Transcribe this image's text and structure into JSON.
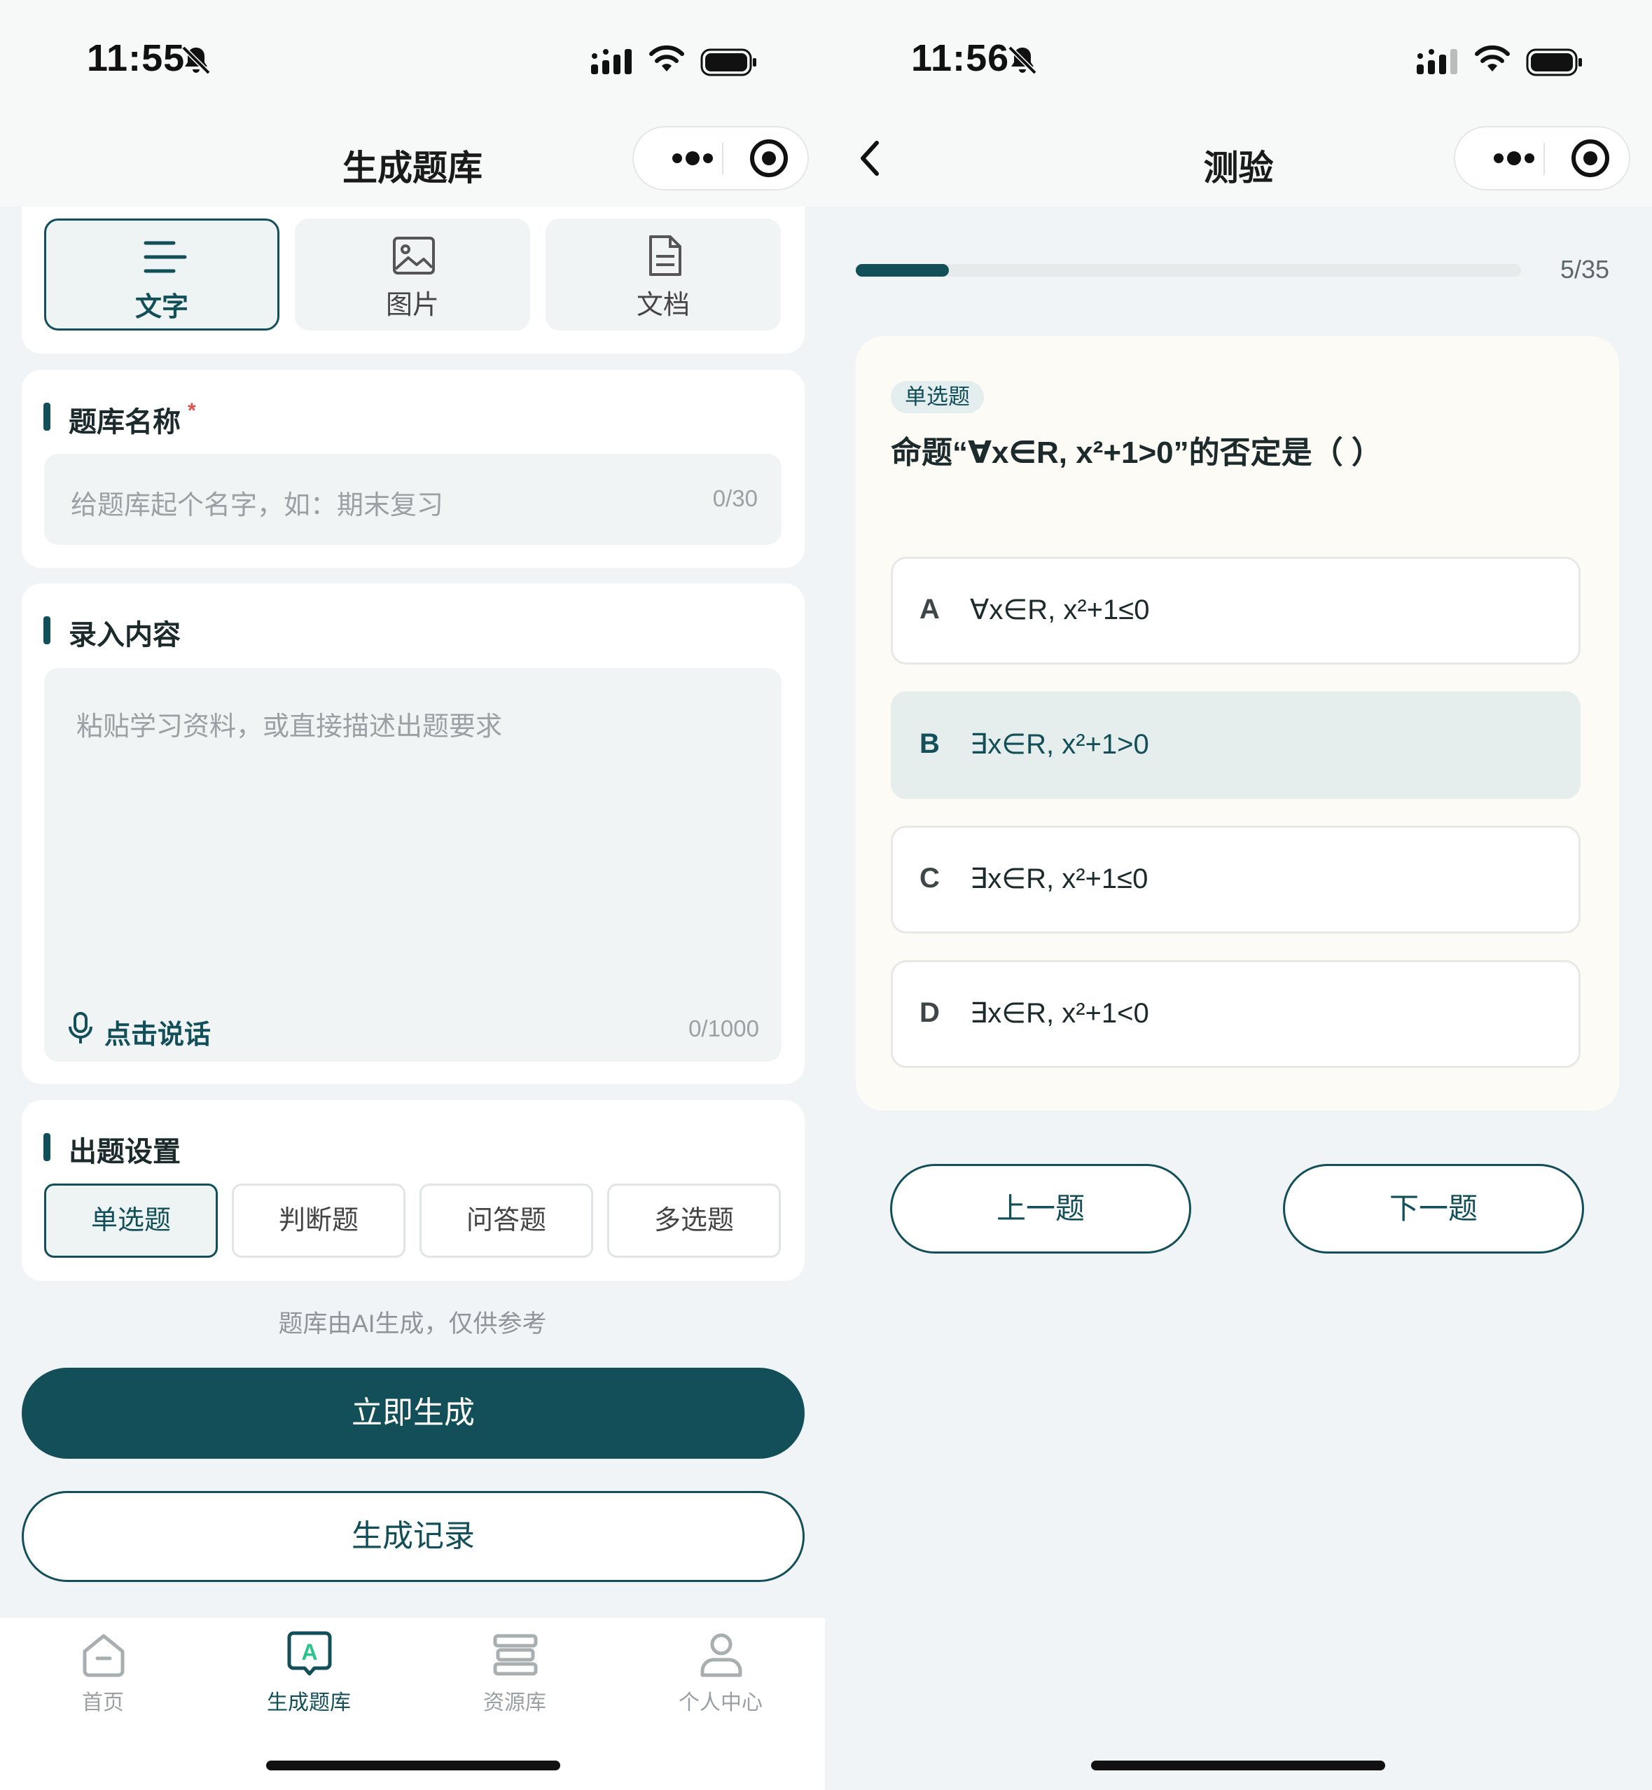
{
  "left": {
    "status": {
      "time": "11:55"
    },
    "nav": {
      "title": "生成题库"
    },
    "input_modes": [
      {
        "label": "文字",
        "icon": "text-lines-icon",
        "active": true
      },
      {
        "label": "图片",
        "icon": "image-icon",
        "active": false
      },
      {
        "label": "文档",
        "icon": "document-icon",
        "active": false
      }
    ],
    "bank_name": {
      "title": "题库名称",
      "required_mark": "*",
      "placeholder": "给题库起个名字，如：期末复习",
      "counter": "0/30"
    },
    "content": {
      "title": "录入内容",
      "placeholder": "粘贴学习资料，或直接描述出题要求",
      "voice_label": "点击说话",
      "counter": "0/1000"
    },
    "settings": {
      "title": "出题设置",
      "types": [
        {
          "label": "单选题",
          "active": true
        },
        {
          "label": "判断题",
          "active": false
        },
        {
          "label": "问答题",
          "active": false
        },
        {
          "label": "多选题",
          "active": false
        }
      ]
    },
    "disclaimer": "题库由AI生成，仅供参考",
    "generate_button": "立即生成",
    "history_button": "生成记录",
    "tabs": [
      {
        "label": "首页",
        "icon": "home-icon",
        "active": false
      },
      {
        "label": "生成题库",
        "icon": "generate-bank-icon",
        "active": true
      },
      {
        "label": "资源库",
        "icon": "library-icon",
        "active": false
      },
      {
        "label": "个人中心",
        "icon": "profile-icon",
        "active": false
      }
    ]
  },
  "right": {
    "status": {
      "time": "11:56"
    },
    "nav": {
      "title": "测验"
    },
    "progress": {
      "current": 5,
      "total": 35,
      "text": "5/35"
    },
    "question": {
      "type_tag": "单选题",
      "text": "命题“∀x∈R, x²+1>0”的否定是（ ）",
      "options": [
        {
          "letter": "A",
          "text": "∀x∈R, x²+1≤0",
          "selected": false
        },
        {
          "letter": "B",
          "text": "∃x∈R, x²+1>0",
          "selected": true
        },
        {
          "letter": "C",
          "text": "∃x∈R, x²+1≤0",
          "selected": false
        },
        {
          "letter": "D",
          "text": "∃x∈R, x²+1<0",
          "selected": false
        }
      ]
    },
    "prev_button": "上一题",
    "next_button": "下一题"
  },
  "colors": {
    "accent": "#124f58",
    "background": "#f1f4f6",
    "question_card": "#fcfbf6",
    "selected_option": "#e6eeed"
  }
}
